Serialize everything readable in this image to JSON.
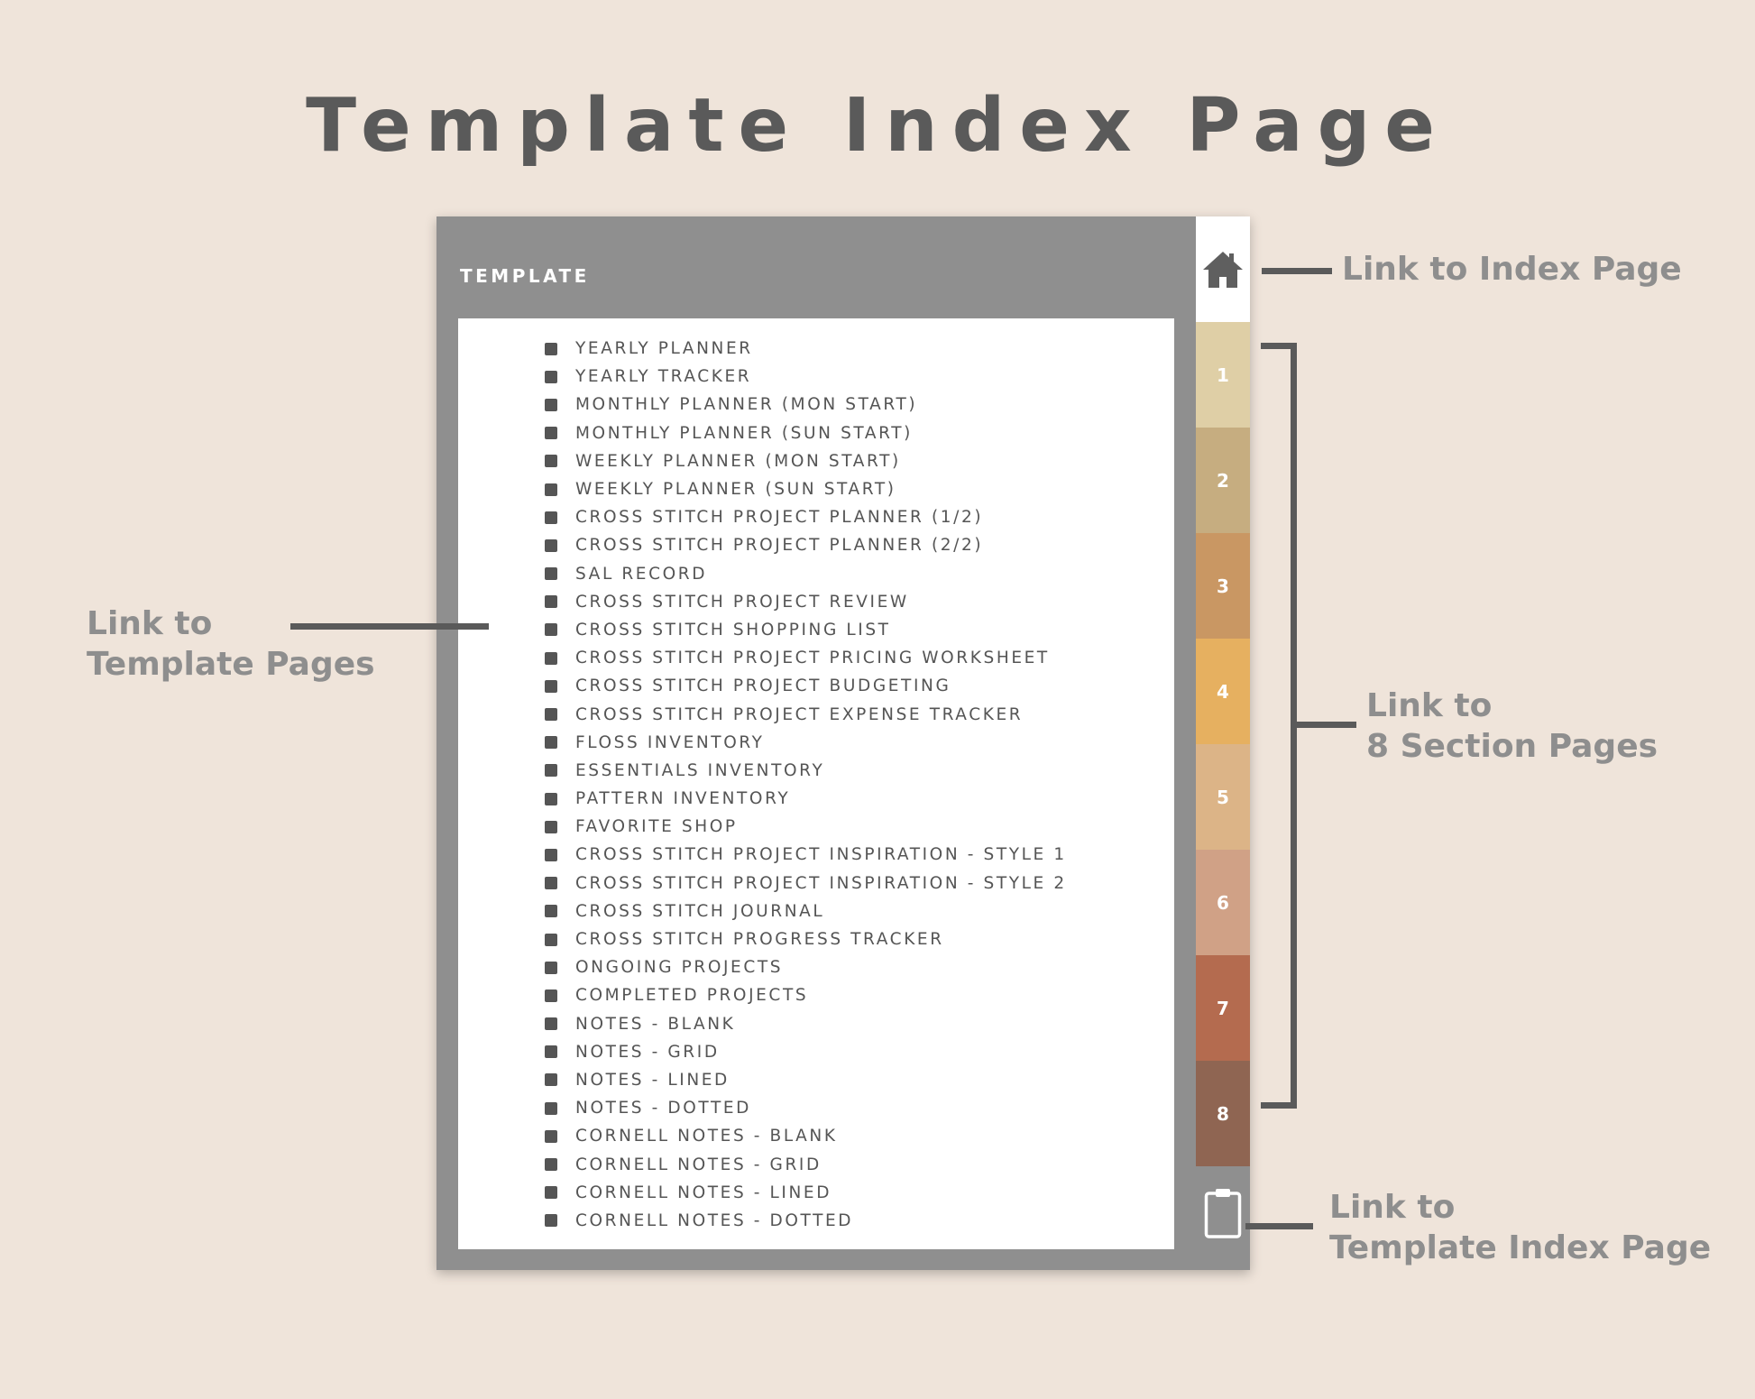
{
  "title": "Template Index Page",
  "header": {
    "label": "TEMPLATE"
  },
  "template_items": [
    "YEARLY PLANNER",
    "YEARLY TRACKER",
    "MONTHLY PLANNER (MON START)",
    "MONTHLY PLANNER (SUN START)",
    "WEEKLY PLANNER (MON START)",
    "WEEKLY PLANNER (SUN START)",
    "CROSS STITCH PROJECT PLANNER (1/2)",
    "CROSS STITCH PROJECT PLANNER (2/2)",
    "SAL RECORD",
    "CROSS STITCH PROJECT REVIEW",
    "CROSS STITCH SHOPPING LIST",
    "CROSS STITCH PROJECT PRICING WORKSHEET",
    "CROSS STITCH PROJECT BUDGETING",
    "CROSS STITCH PROJECT EXPENSE TRACKER",
    "FLOSS INVENTORY",
    "ESSENTIALS INVENTORY",
    "PATTERN INVENTORY",
    "FAVORITE SHOP",
    "CROSS STITCH PROJECT INSPIRATION - STYLE 1",
    "CROSS STITCH PROJECT INSPIRATION - STYLE 2",
    "CROSS STITCH JOURNAL",
    "CROSS STITCH PROGRESS TRACKER",
    "ONGOING PROJECTS",
    "COMPLETED PROJECTS",
    "NOTES - BLANK",
    "NOTES - GRID",
    "NOTES - LINED",
    "NOTES - DOTTED",
    "CORNELL NOTES - BLANK",
    "CORNELL NOTES - GRID",
    "CORNELL NOTES - LINED",
    "CORNELL NOTES - DOTTED"
  ],
  "sections": [
    {
      "label": "1",
      "color": "#dfcfa6"
    },
    {
      "label": "2",
      "color": "#c6ad80"
    },
    {
      "label": "3",
      "color": "#c99763"
    },
    {
      "label": "4",
      "color": "#e6b060"
    },
    {
      "label": "5",
      "color": "#dcb487"
    },
    {
      "label": "6",
      "color": "#d0a186"
    },
    {
      "label": "7",
      "color": "#b46b4f"
    },
    {
      "label": "8",
      "color": "#8f6552"
    }
  ],
  "icons": {
    "home": "home-icon",
    "clipboard": "clipboard-icon"
  },
  "annotations": {
    "index_page": "Link to Index Page",
    "template_pages_line1": "Link to",
    "template_pages_line2": "Template Pages",
    "section_pages_line1": "Link to",
    "section_pages_line2": "8 Section Pages",
    "template_index_line1": "Link to",
    "template_index_line2": "Template Index Page"
  },
  "colors": {
    "background": "#efe4da",
    "device_frame": "#8f8f8f",
    "title_text": "#5a5a5a",
    "annotation_text": "#8e8e8e",
    "list_text": "#555555"
  }
}
